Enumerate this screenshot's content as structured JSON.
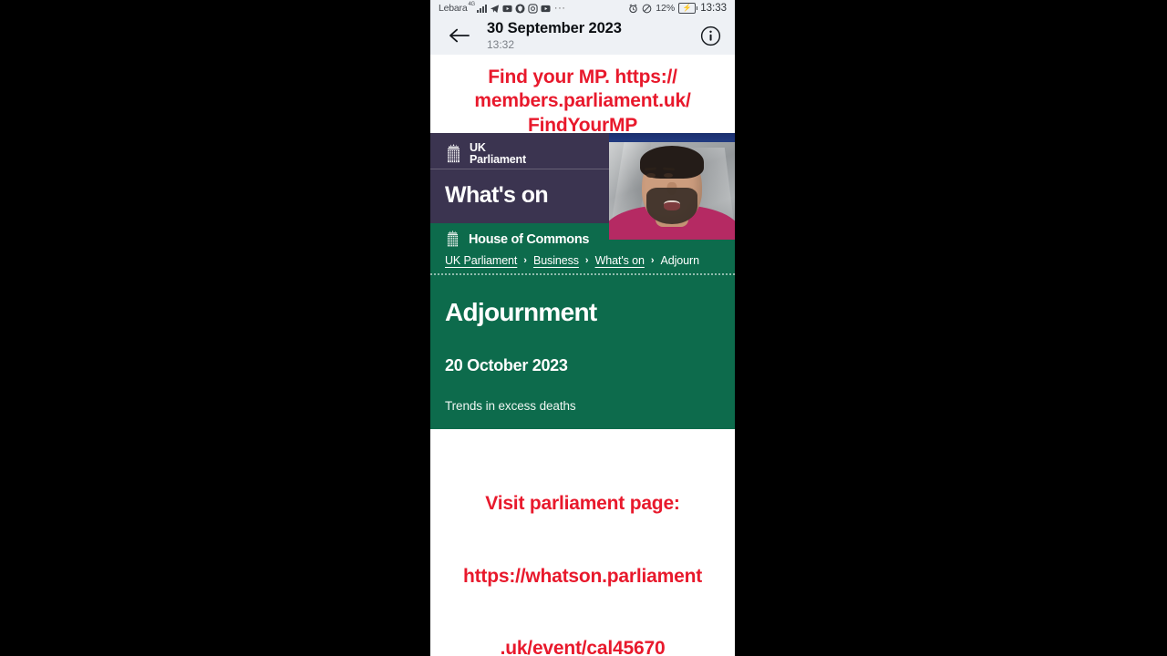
{
  "status_bar": {
    "carrier": "Lebara",
    "network": "4G",
    "icons": [
      "signal-bars-icon",
      "telegram-icon",
      "youtube-icon",
      "brave-icon",
      "instagram-icon",
      "youtube-music-icon",
      "more-dots-icon"
    ],
    "more_dots": "···",
    "alarm_icon": "alarm-icon",
    "dnd_icon": "do-not-disturb-icon",
    "battery_percent": "12%",
    "battery_icon": "battery-charging-icon",
    "time": "13:33"
  },
  "app_header": {
    "back_icon": "back-arrow-icon",
    "title": "30 September 2023",
    "subtitle": "13:32",
    "info_icon": "info-icon"
  },
  "caption_top": {
    "text": "Find your MP. https://\nmembers.parliament.uk/\nFindYourMP"
  },
  "caption_bottom": {
    "line1": "Visit parliament page:",
    "line2": "https://whatson.parliament",
    "line3": ".uk/event/cal45670"
  },
  "parliament_page": {
    "brand": {
      "logo_icon": "portcullis-icon",
      "line1": "UK",
      "line2": "Parliament"
    },
    "section_title": "What's on",
    "commons": {
      "logo_icon": "portcullis-icon",
      "label": "House of Commons"
    },
    "breadcrumb": {
      "separator": "›",
      "items": [
        {
          "label": "UK Parliament",
          "link": true
        },
        {
          "label": "Business",
          "link": true
        },
        {
          "label": "What's on",
          "link": true
        },
        {
          "label": "Adjourn",
          "link": false
        }
      ]
    },
    "event": {
      "title": "Adjournment",
      "date": "20 October 2023",
      "description": "Trends in excess deaths"
    }
  },
  "webcam_overlay": {
    "name": "video-presenter-overlay"
  },
  "colors": {
    "parliament_purple": "#3b3450",
    "commons_green": "#0d6b4c",
    "caption_red": "#e8192c",
    "status_bg": "#eef1f5",
    "letterbox": "#000000"
  }
}
